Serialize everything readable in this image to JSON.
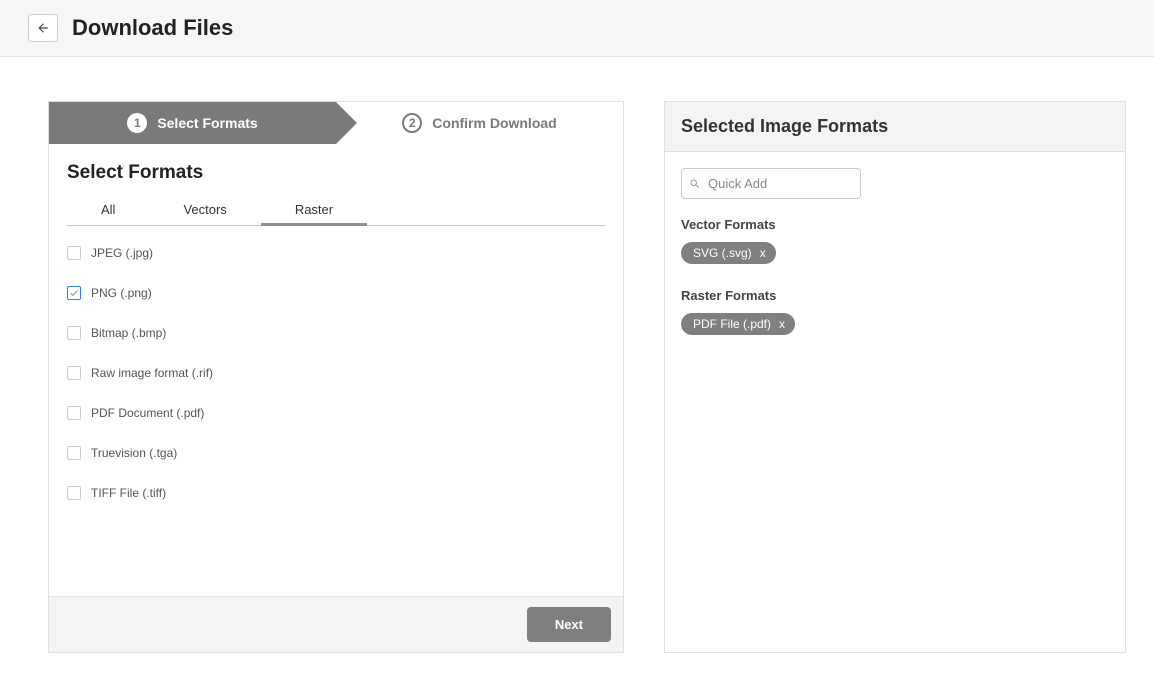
{
  "header": {
    "title": "Download Files"
  },
  "stepper": {
    "steps": [
      {
        "num": "1",
        "label": "Select Formats",
        "active": true
      },
      {
        "num": "2",
        "label": "Confirm Download",
        "active": false
      }
    ]
  },
  "panel": {
    "heading": "Select Formats",
    "tabs": [
      {
        "label": "All",
        "active": false
      },
      {
        "label": "Vectors",
        "active": false
      },
      {
        "label": "Raster",
        "active": true
      }
    ],
    "formats": [
      {
        "label": "JPEG (.jpg)",
        "checked": false
      },
      {
        "label": "PNG (.png)",
        "checked": true
      },
      {
        "label": "Bitmap (.bmp)",
        "checked": false
      },
      {
        "label": "Raw image format (.rif)",
        "checked": false
      },
      {
        "label": "PDF Document (.pdf)",
        "checked": false
      },
      {
        "label": "Truevision (.tga)",
        "checked": false
      },
      {
        "label": "TIFF File (.tiff)",
        "checked": false
      }
    ],
    "next_label": "Next"
  },
  "sidebar": {
    "title": "Selected Image Formats",
    "search_placeholder": "Quick Add",
    "groups": [
      {
        "label": "Vector Formats",
        "chips": [
          {
            "label": "SVG (.svg)"
          }
        ]
      },
      {
        "label": "Raster Formats",
        "chips": [
          {
            "label": "PDF File (.pdf)"
          }
        ]
      }
    ]
  }
}
